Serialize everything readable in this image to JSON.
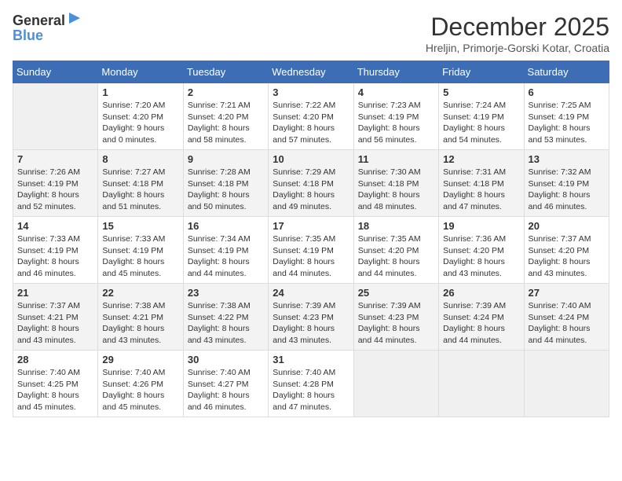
{
  "logo": {
    "general": "General",
    "blue": "Blue"
  },
  "title": "December 2025",
  "subtitle": "Hreljin, Primorje-Gorski Kotar, Croatia",
  "days": [
    "Sunday",
    "Monday",
    "Tuesday",
    "Wednesday",
    "Thursday",
    "Friday",
    "Saturday"
  ],
  "weeks": [
    [
      {
        "date": "",
        "info": ""
      },
      {
        "date": "1",
        "info": "Sunrise: 7:20 AM\nSunset: 4:20 PM\nDaylight: 9 hours\nand 0 minutes."
      },
      {
        "date": "2",
        "info": "Sunrise: 7:21 AM\nSunset: 4:20 PM\nDaylight: 8 hours\nand 58 minutes."
      },
      {
        "date": "3",
        "info": "Sunrise: 7:22 AM\nSunset: 4:20 PM\nDaylight: 8 hours\nand 57 minutes."
      },
      {
        "date": "4",
        "info": "Sunrise: 7:23 AM\nSunset: 4:19 PM\nDaylight: 8 hours\nand 56 minutes."
      },
      {
        "date": "5",
        "info": "Sunrise: 7:24 AM\nSunset: 4:19 PM\nDaylight: 8 hours\nand 54 minutes."
      },
      {
        "date": "6",
        "info": "Sunrise: 7:25 AM\nSunset: 4:19 PM\nDaylight: 8 hours\nand 53 minutes."
      }
    ],
    [
      {
        "date": "7",
        "info": "Sunrise: 7:26 AM\nSunset: 4:19 PM\nDaylight: 8 hours\nand 52 minutes."
      },
      {
        "date": "8",
        "info": "Sunrise: 7:27 AM\nSunset: 4:18 PM\nDaylight: 8 hours\nand 51 minutes."
      },
      {
        "date": "9",
        "info": "Sunrise: 7:28 AM\nSunset: 4:18 PM\nDaylight: 8 hours\nand 50 minutes."
      },
      {
        "date": "10",
        "info": "Sunrise: 7:29 AM\nSunset: 4:18 PM\nDaylight: 8 hours\nand 49 minutes."
      },
      {
        "date": "11",
        "info": "Sunrise: 7:30 AM\nSunset: 4:18 PM\nDaylight: 8 hours\nand 48 minutes."
      },
      {
        "date": "12",
        "info": "Sunrise: 7:31 AM\nSunset: 4:18 PM\nDaylight: 8 hours\nand 47 minutes."
      },
      {
        "date": "13",
        "info": "Sunrise: 7:32 AM\nSunset: 4:19 PM\nDaylight: 8 hours\nand 46 minutes."
      }
    ],
    [
      {
        "date": "14",
        "info": "Sunrise: 7:33 AM\nSunset: 4:19 PM\nDaylight: 8 hours\nand 46 minutes."
      },
      {
        "date": "15",
        "info": "Sunrise: 7:33 AM\nSunset: 4:19 PM\nDaylight: 8 hours\nand 45 minutes."
      },
      {
        "date": "16",
        "info": "Sunrise: 7:34 AM\nSunset: 4:19 PM\nDaylight: 8 hours\nand 44 minutes."
      },
      {
        "date": "17",
        "info": "Sunrise: 7:35 AM\nSunset: 4:19 PM\nDaylight: 8 hours\nand 44 minutes."
      },
      {
        "date": "18",
        "info": "Sunrise: 7:35 AM\nSunset: 4:20 PM\nDaylight: 8 hours\nand 44 minutes."
      },
      {
        "date": "19",
        "info": "Sunrise: 7:36 AM\nSunset: 4:20 PM\nDaylight: 8 hours\nand 43 minutes."
      },
      {
        "date": "20",
        "info": "Sunrise: 7:37 AM\nSunset: 4:20 PM\nDaylight: 8 hours\nand 43 minutes."
      }
    ],
    [
      {
        "date": "21",
        "info": "Sunrise: 7:37 AM\nSunset: 4:21 PM\nDaylight: 8 hours\nand 43 minutes."
      },
      {
        "date": "22",
        "info": "Sunrise: 7:38 AM\nSunset: 4:21 PM\nDaylight: 8 hours\nand 43 minutes."
      },
      {
        "date": "23",
        "info": "Sunrise: 7:38 AM\nSunset: 4:22 PM\nDaylight: 8 hours\nand 43 minutes."
      },
      {
        "date": "24",
        "info": "Sunrise: 7:39 AM\nSunset: 4:23 PM\nDaylight: 8 hours\nand 43 minutes."
      },
      {
        "date": "25",
        "info": "Sunrise: 7:39 AM\nSunset: 4:23 PM\nDaylight: 8 hours\nand 44 minutes."
      },
      {
        "date": "26",
        "info": "Sunrise: 7:39 AM\nSunset: 4:24 PM\nDaylight: 8 hours\nand 44 minutes."
      },
      {
        "date": "27",
        "info": "Sunrise: 7:40 AM\nSunset: 4:24 PM\nDaylight: 8 hours\nand 44 minutes."
      }
    ],
    [
      {
        "date": "28",
        "info": "Sunrise: 7:40 AM\nSunset: 4:25 PM\nDaylight: 8 hours\nand 45 minutes."
      },
      {
        "date": "29",
        "info": "Sunrise: 7:40 AM\nSunset: 4:26 PM\nDaylight: 8 hours\nand 45 minutes."
      },
      {
        "date": "30",
        "info": "Sunrise: 7:40 AM\nSunset: 4:27 PM\nDaylight: 8 hours\nand 46 minutes."
      },
      {
        "date": "31",
        "info": "Sunrise: 7:40 AM\nSunset: 4:28 PM\nDaylight: 8 hours\nand 47 minutes."
      },
      {
        "date": "",
        "info": ""
      },
      {
        "date": "",
        "info": ""
      },
      {
        "date": "",
        "info": ""
      }
    ]
  ]
}
